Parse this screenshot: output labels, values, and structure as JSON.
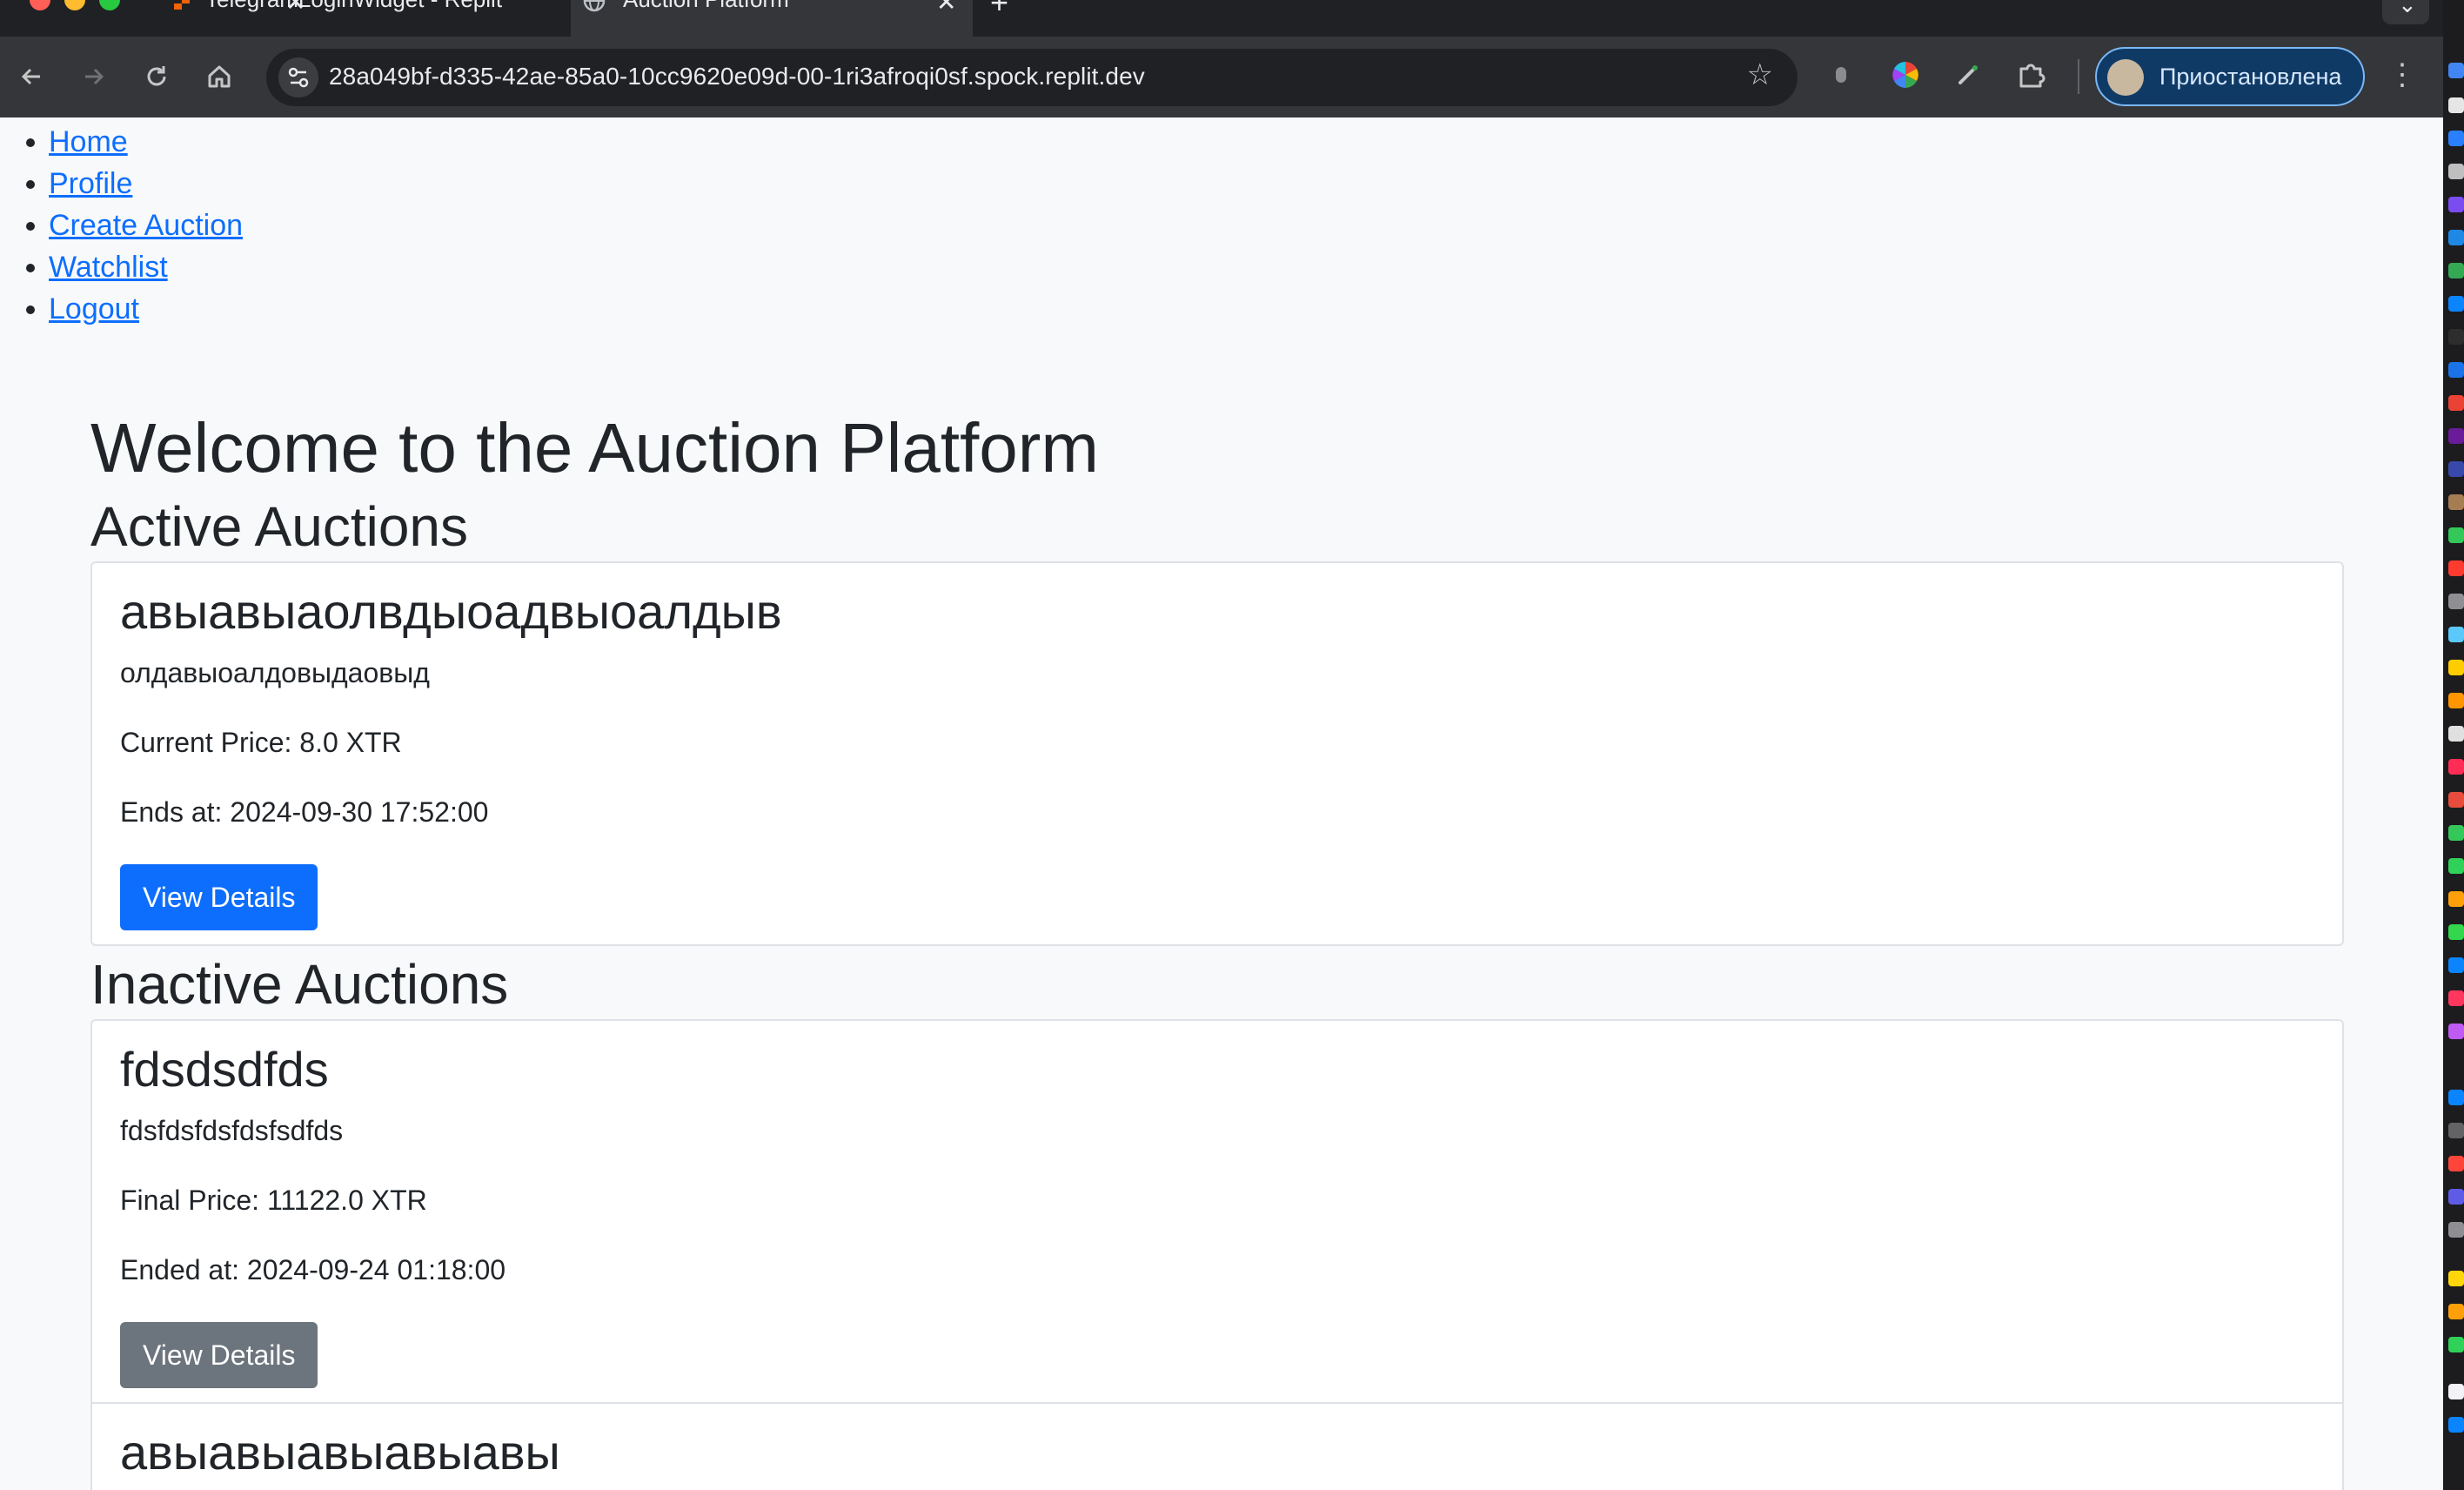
{
  "browser": {
    "tabs": [
      {
        "title": "TelegramLoginWidget - Replit",
        "active": false
      },
      {
        "title": "Auction Platform",
        "active": true
      }
    ],
    "url": "28a049bf-d335-42ae-85a0-10cc9620e09d-00-1ri3afroqi0sf.spock.replit.dev",
    "profile_status": "Приостановлена",
    "icons": [
      "back-icon",
      "forward-icon",
      "reload-icon",
      "home-icon",
      "site-settings-icon",
      "bookmark-star-icon",
      "extension-icon",
      "extensions-puzzle-icon",
      "more-menu-icon"
    ]
  },
  "nav": {
    "items": [
      {
        "label": "Home"
      },
      {
        "label": "Profile"
      },
      {
        "label": "Create Auction"
      },
      {
        "label": "Watchlist"
      },
      {
        "label": "Logout"
      }
    ]
  },
  "main": {
    "title": "Welcome to the Auction Platform",
    "active_heading": "Active Auctions",
    "inactive_heading": "Inactive Auctions",
    "active_auctions": [
      {
        "title": "авыавыаолвдыоадвыоалдыв",
        "description": "олдавыоалдовыдаовыд",
        "price": "Current Price: 8.0 XTR",
        "time": "Ends at: 2024-09-30 17:52:00",
        "button": "View Details"
      }
    ],
    "inactive_auctions": [
      {
        "title": "fdsdsdfds",
        "description": "fdsfdsfdsfdsfsdfds",
        "price": "Final Price: 11122.0 XTR",
        "time": "Ended at: 2024-09-24 01:18:00",
        "button": "View Details"
      },
      {
        "title": "авыавыавыавыавы"
      }
    ]
  },
  "colors": {
    "link": "#0d6efd",
    "primary_button": "#0d6efd",
    "secondary_button": "#6c757d",
    "page_background": "#f8f9fa"
  }
}
